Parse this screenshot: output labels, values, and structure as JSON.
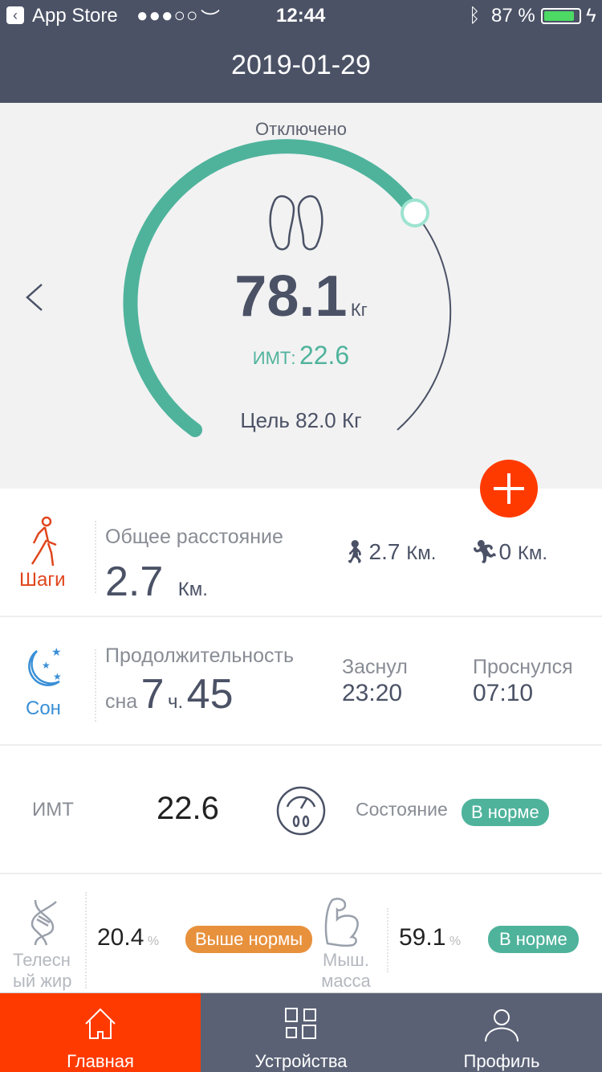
{
  "status_bar": {
    "back_app": "App Store",
    "time": "12:44",
    "battery": "87 %"
  },
  "header": {
    "title": "2019-01-29"
  },
  "gauge": {
    "connection": "Отключено",
    "weight": "78.1",
    "weight_unit": "Кг",
    "bmi_label": "ИМТ:",
    "bmi": "22.6",
    "goal": "Цель 82.0 Кг",
    "progress_fraction": 0.68,
    "accent": "#4fb39c"
  },
  "steps": {
    "label": "Шаги",
    "title": "Общее расстояние",
    "value": "2.7",
    "unit": "Км.",
    "walk_value": "2.7",
    "walk_unit": "Км.",
    "run_value": "0",
    "run_unit": "Км.",
    "color": "#e0451c"
  },
  "sleep": {
    "label": "Сон",
    "title": "Продолжительность",
    "prefix": "сна",
    "hours": "7",
    "hours_unit": "ч.",
    "minutes": "45",
    "fell_asleep_label": "Заснул",
    "fell_asleep": "23:20",
    "woke_label": "Проснулся",
    "woke": "07:10",
    "color": "#3a8fd6"
  },
  "bmi": {
    "label": "ИМТ",
    "value": "22.6",
    "state_label": "Состояние",
    "state": "В норме"
  },
  "body_fat": {
    "label_line1": "Телесн",
    "label_line2": "ый жир",
    "value": "20.4",
    "unit": "%",
    "state": "Выше нормы",
    "state_color": "#e8913d"
  },
  "muscle": {
    "label_line1": "Мыш.",
    "label_line2": "масса",
    "value": "59.1",
    "unit": "%",
    "state": "В норме",
    "state_color": "#4fb39c"
  },
  "tabs": [
    {
      "label": "Главная",
      "icon": "home-icon",
      "active": true
    },
    {
      "label": "Устройства",
      "icon": "devices-icon"
    },
    {
      "label": "Профиль",
      "icon": "profile-icon"
    }
  ],
  "add_button_color": "#ff3a00"
}
